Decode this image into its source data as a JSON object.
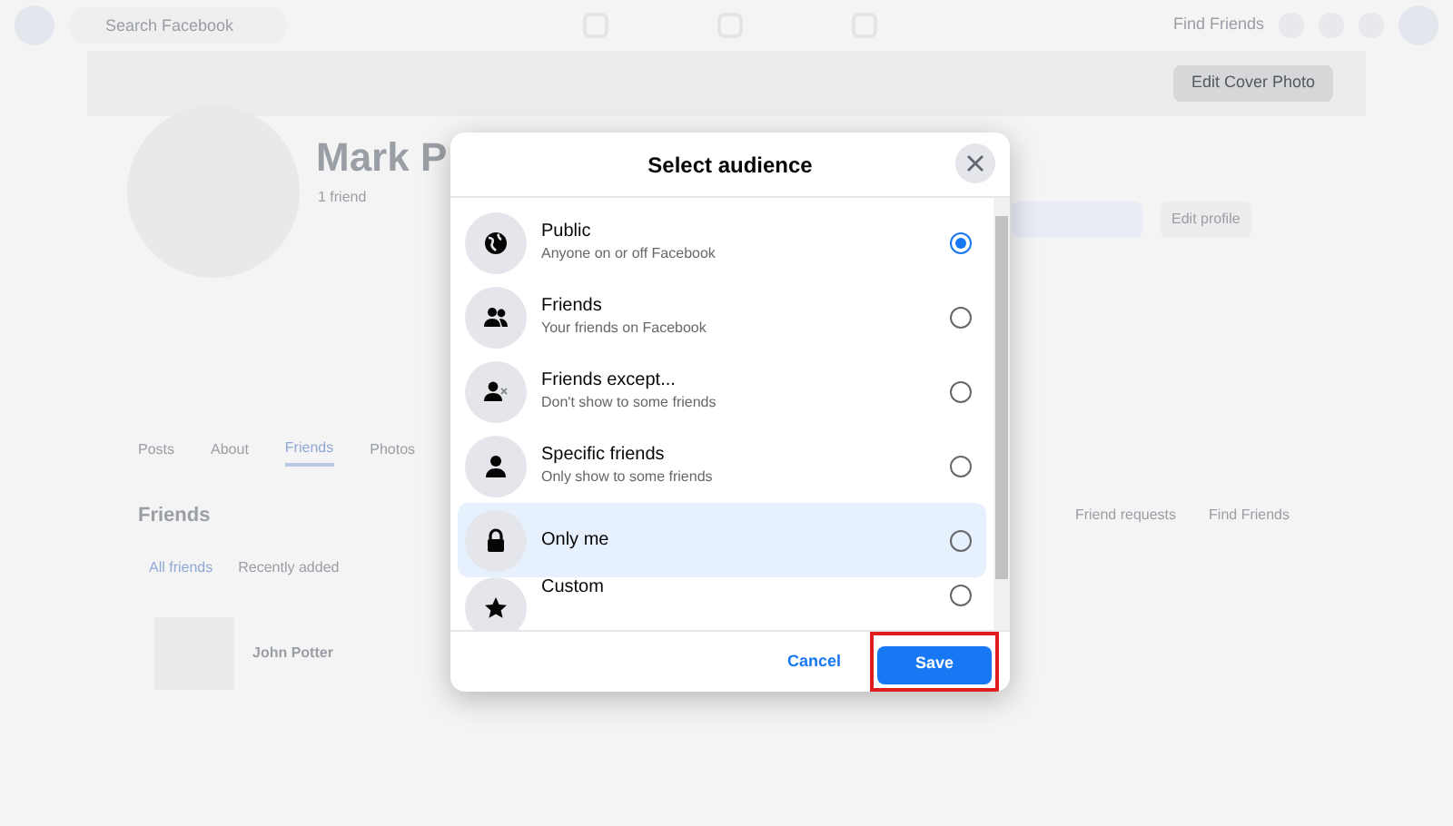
{
  "background": {
    "search": {
      "placeholder": "Search Facebook"
    },
    "nav_link": "Find Friends",
    "cover_button": "Edit Cover Photo",
    "profile_name": "Mark P",
    "friend_count": "1 friend",
    "edit_button": "Edit profile",
    "tabs": [
      {
        "label": "Posts",
        "selected": false
      },
      {
        "label": "About",
        "selected": false
      },
      {
        "label": "Friends",
        "selected": true
      },
      {
        "label": "Photos",
        "selected": false
      }
    ],
    "section_title": "Friends",
    "subtabs": [
      {
        "label": "All friends",
        "selected": true
      },
      {
        "label": "Recently added",
        "selected": false
      }
    ],
    "section_links": [
      "Friend requests",
      "Find Friends"
    ],
    "friend": {
      "name": "John Potter"
    }
  },
  "dialog": {
    "title": "Select audience",
    "options": [
      {
        "label": "Public",
        "description": "Anyone on or off Facebook",
        "selected": true,
        "highlighted": false
      },
      {
        "label": "Friends",
        "description": "Your friends on Facebook",
        "selected": false,
        "highlighted": false
      },
      {
        "label": "Friends except...",
        "description": "Don't show to some friends",
        "selected": false,
        "highlighted": false
      },
      {
        "label": "Specific friends",
        "description": "Only show to some friends",
        "selected": false,
        "highlighted": false
      },
      {
        "label": "Only me",
        "selected": false,
        "highlighted": true
      },
      {
        "label": "Custom",
        "selected": false,
        "highlighted": false
      }
    ],
    "cancel": "Cancel",
    "save": {
      "label": "Save",
      "highlighted": true
    }
  }
}
